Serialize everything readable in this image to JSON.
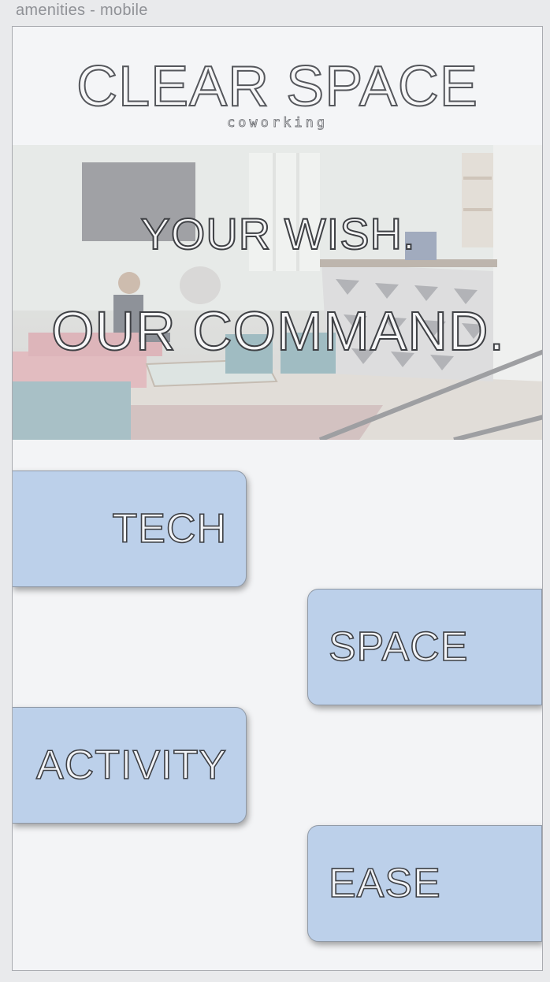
{
  "artboard": {
    "label": "amenities - mobile"
  },
  "header": {
    "brand": "CLEAR SPACE",
    "subtitle": "coworking"
  },
  "hero": {
    "line1": "YOUR WISH.",
    "line2": "OUR COMMAND."
  },
  "tiles": [
    {
      "label": "TECH"
    },
    {
      "label": "SPACE"
    },
    {
      "label": "ACTIVITY"
    },
    {
      "label": "EASE"
    }
  ],
  "colors": {
    "tile_fill": "#bcd0ea",
    "page_bg": "#f3f4f6",
    "text_outline": "#3e4045"
  }
}
